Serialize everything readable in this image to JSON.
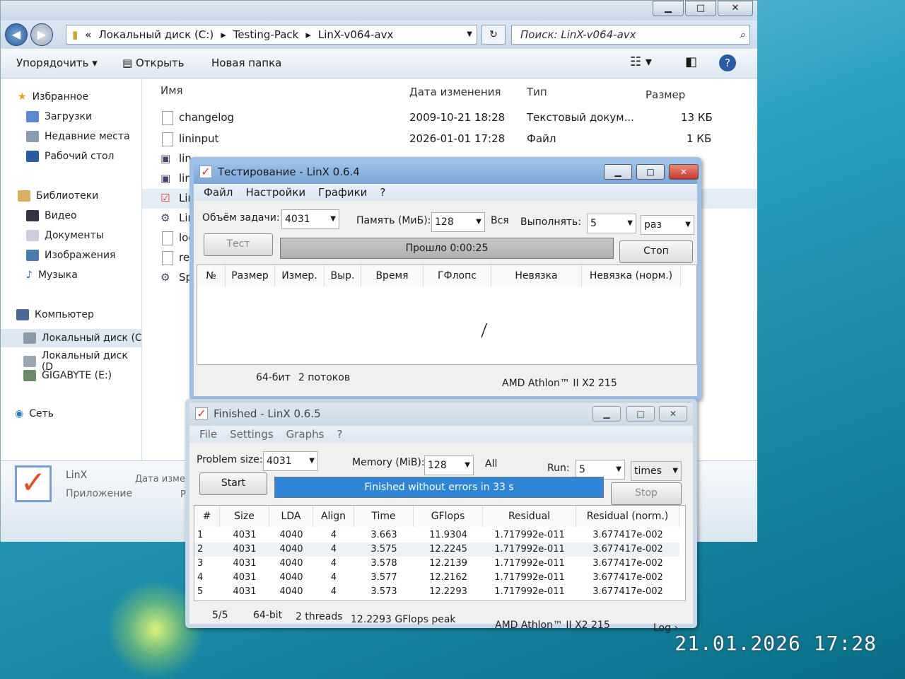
{
  "explorer": {
    "address": [
      "«",
      "Локальный диск (C:)",
      "Testing-Pack",
      "LinX-v064-avx"
    ],
    "search_placeholder": "Поиск: LinX-v064-avx",
    "toolbar": {
      "organize": "Упорядочить",
      "open": "Открыть",
      "new_folder": "Новая папка"
    },
    "sidebar": {
      "favorites": "Избранное",
      "downloads": "Загрузки",
      "recent": "Недавние места",
      "desktop": "Рабочий стол",
      "libraries": "Библиотеки",
      "video": "Видео",
      "documents": "Документы",
      "images": "Изображения",
      "music": "Музыка",
      "computer": "Компьютер",
      "disk_c": "Локальный диск (C",
      "disk_d": "Локальный диск (D",
      "gigabyte": "GIGABYTE (E:)",
      "network": "Сеть"
    },
    "columns": {
      "name": "Имя",
      "date": "Дата изменения",
      "type": "Тип",
      "size": "Размер"
    },
    "files": [
      {
        "name": "changelog",
        "date": "2009-10-21 18:28",
        "type": "Текстовый докум...",
        "size": "13 КБ"
      },
      {
        "name": "lininput",
        "date": "2026-01-01 17:28",
        "type": "Файл",
        "size": "1 КБ"
      },
      {
        "name": "lin",
        "date": "",
        "type": "",
        "size": ""
      },
      {
        "name": "lin",
        "date": "",
        "type": "",
        "size": ""
      },
      {
        "name": "Lin",
        "date": "",
        "type": "",
        "size": ""
      },
      {
        "name": "Lin",
        "date": "",
        "type": "",
        "size": ""
      },
      {
        "name": "loc",
        "date": "",
        "type": "",
        "size": ""
      },
      {
        "name": "rea",
        "date": "",
        "type": "",
        "size": ""
      },
      {
        "name": "Sp",
        "date": "",
        "type": "",
        "size": ""
      }
    ],
    "details": {
      "name": "LinX",
      "type": "Приложение",
      "date_label": "Дата изме",
      "extra": "Р"
    }
  },
  "linx_ru": {
    "title": "Тестирование - LinX 0.6.4",
    "menu": [
      "Файл",
      "Настройки",
      "Графики",
      "?"
    ],
    "problem_label": "Объём задачи:",
    "problem_value": "4031",
    "memory_label": "Память (МиБ):",
    "memory_value": "128",
    "all_label": "Вся",
    "run_label": "Выполнять:",
    "run_value": "5",
    "run_unit": "раз",
    "test_button": "Тест",
    "progress_text": "Прошло 0:00:25",
    "stop_button": "Стоп",
    "columns": [
      "№",
      "Размер",
      "Измер.",
      "Выр.",
      "Время",
      "ГФлопс",
      "Невязка",
      "Невязка (норм.)"
    ],
    "status": {
      "bits": "64-бит",
      "threads": "2 потоков",
      "cpu": "AMD Athlon™ II X2 215"
    }
  },
  "linx_en": {
    "title": "Finished - LinX 0.6.5",
    "menu": [
      "File",
      "Settings",
      "Graphs",
      "?"
    ],
    "problem_label": "Problem size:",
    "problem_value": "4031",
    "memory_label": "Memory (MiB):",
    "memory_value": "128",
    "all_label": "All",
    "run_label": "Run:",
    "run_value": "5",
    "run_unit": "times",
    "start_button": "Start",
    "progress_text": "Finished without errors in 33 s",
    "progress_fraction": 1.0,
    "stop_button": "Stop",
    "columns": [
      "#",
      "Size",
      "LDA",
      "Align",
      "Time",
      "GFlops",
      "Residual",
      "Residual (norm.)"
    ],
    "rows": [
      [
        "1",
        "4031",
        "4040",
        "4",
        "3.663",
        "11.9304",
        "1.717992e-011",
        "3.677417e-002"
      ],
      [
        "2",
        "4031",
        "4040",
        "4",
        "3.575",
        "12.2245",
        "1.717992e-011",
        "3.677417e-002"
      ],
      [
        "3",
        "4031",
        "4040",
        "4",
        "3.578",
        "12.2139",
        "1.717992e-011",
        "3.677417e-002"
      ],
      [
        "4",
        "4031",
        "4040",
        "4",
        "3.577",
        "12.2162",
        "1.717992e-011",
        "3.677417e-002"
      ],
      [
        "5",
        "4031",
        "4040",
        "4",
        "3.573",
        "12.2293",
        "1.717992e-011",
        "3.677417e-002"
      ]
    ],
    "status": {
      "count": "5/5",
      "bits": "64-bit",
      "threads": "2 threads",
      "peak": "12.2293 GFlops peak",
      "cpu": "AMD Athlon™ II X2 215",
      "log": "Log ›"
    }
  },
  "photo_timestamp": "21.01.2026 17:28",
  "colors": {
    "progress_blue": "#2f86d6",
    "progress_gray": "#c8c8c8",
    "accent_check": "#dd3322"
  }
}
